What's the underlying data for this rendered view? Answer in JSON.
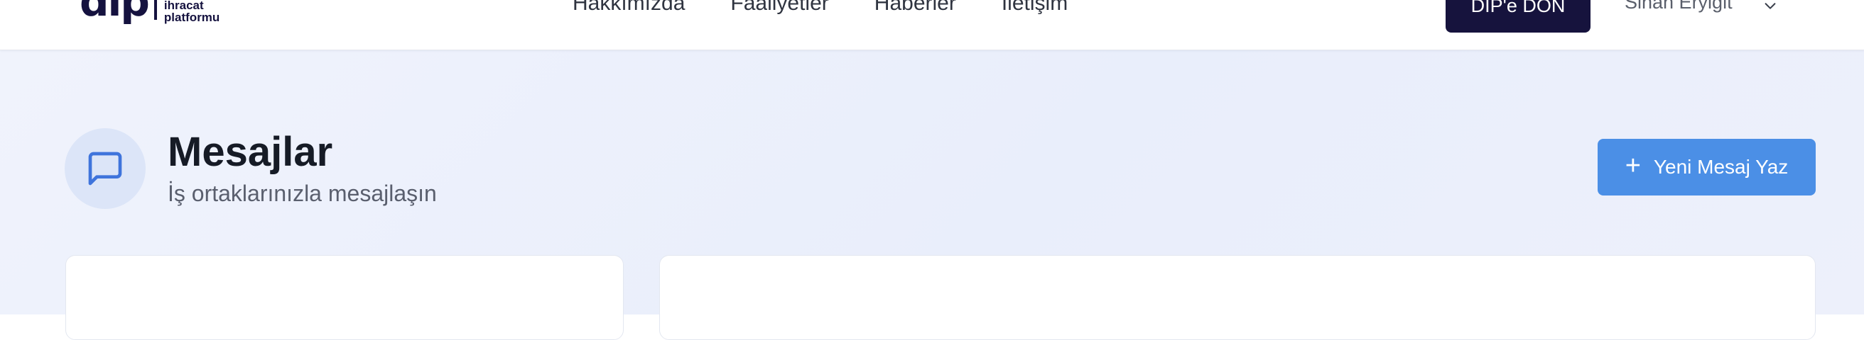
{
  "header": {
    "logo": {
      "mark": "dip",
      "line1": "ihracat",
      "line2": "platformu"
    },
    "nav": [
      {
        "label": "Hakkımızda"
      },
      {
        "label": "Faaliyetler"
      },
      {
        "label": "Haberler"
      },
      {
        "label": "İletişim"
      }
    ],
    "return_label": "DİP'e DÖN",
    "user_name": "Sinan Eryiğit"
  },
  "page": {
    "title": "Mesajlar",
    "subtitle": "İş ortaklarınızla mesajlaşın",
    "new_message_label": "Yeni Mesaj Yaz",
    "icon": "message-square-icon"
  },
  "colors": {
    "brand_dark": "#16133d",
    "accent_blue": "#4b8fe6",
    "icon_blue": "#3f74dc"
  }
}
